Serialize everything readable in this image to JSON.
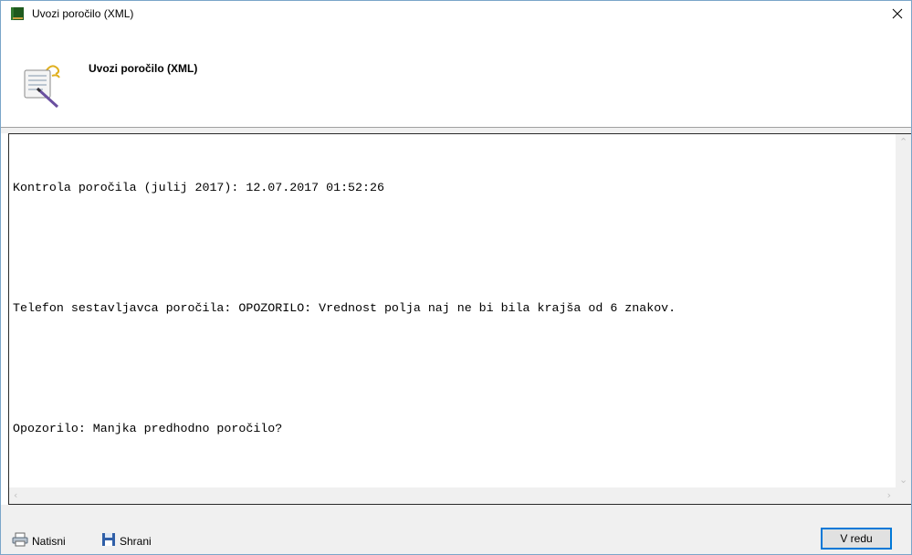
{
  "window": {
    "title": "Uvozi poročilo (XML)"
  },
  "header": {
    "title": "Uvozi poročilo (XML)"
  },
  "report": {
    "lines": [
      "Kontrola poročila (julij 2017): 12.07.2017 01:52:26",
      "",
      "Telefon sestavljavca poročila: OPOZORILO: Vrednost polja naj ne bi bila krajša od 6 znakov.",
      "",
      "Opozorilo: Manjka predhodno poročilo?"
    ]
  },
  "footer": {
    "print_label": "Natisni",
    "save_label": "Shrani",
    "ok_label": "V redu"
  }
}
